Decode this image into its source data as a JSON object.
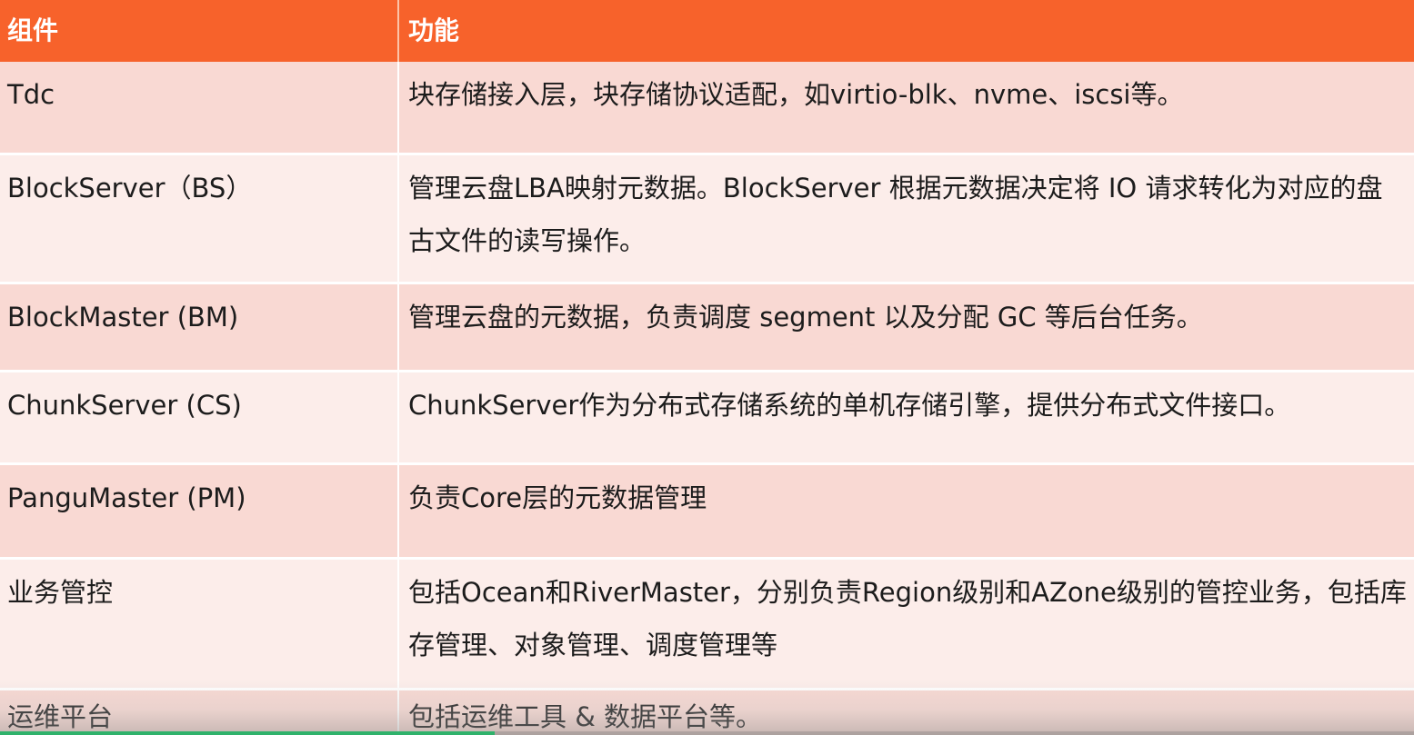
{
  "table": {
    "headers": [
      "组件",
      "功能"
    ],
    "rows": [
      {
        "component": "Tdc",
        "function": "块存储接入层，块存储协议适配，如virtio-blk、nvme、iscsi等。"
      },
      {
        "component": "BlockServer（BS）",
        "function": "管理云盘LBA映射元数据。BlockServer 根据元数据决定将 IO 请求转化为对应的盘古文件的读写操作。"
      },
      {
        "component": "BlockMaster (BM)",
        "function": "管理云盘的元数据，负责调度 segment 以及分配 GC 等后台任务。"
      },
      {
        "component": "ChunkServer (CS)",
        "function": "ChunkServer作为分布式存储系统的单机存储引擎，提供分布式文件接口。"
      },
      {
        "component": "PanguMaster (PM)",
        "function": "负责Core层的元数据管理"
      },
      {
        "component": "业务管控",
        "function": "包括Ocean和RiverMaster，分别负责Region级别和AZone级别的管控业务，包括库存管理、对象管理、调度管理等"
      },
      {
        "component": "运维平台",
        "function": "包括运维工具 & 数据平台等。"
      }
    ]
  },
  "colors": {
    "header": "#f7622b",
    "row_odd": "#f9d9d3",
    "row_even": "#fcedea",
    "progress": "#2fb26b"
  },
  "video_progress": 0.35
}
